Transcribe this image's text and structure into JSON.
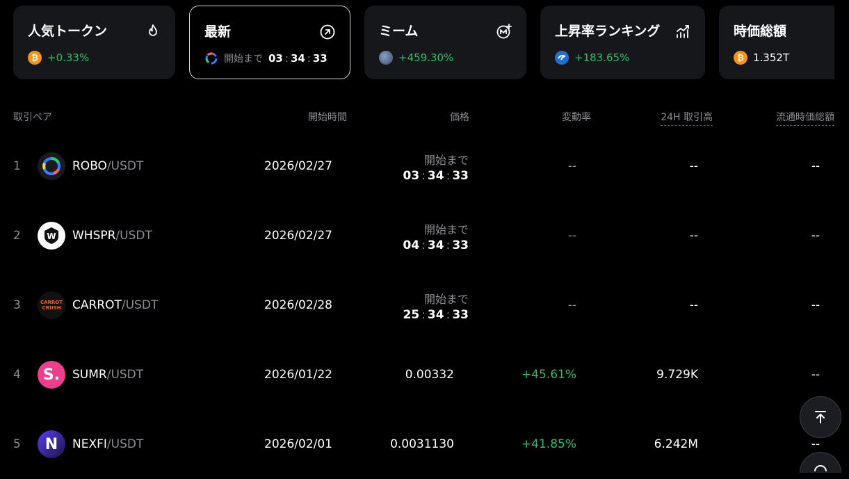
{
  "cards": [
    {
      "title": "人気トークン",
      "icon": "flame-icon",
      "coin": "₿",
      "value": "+0.33%"
    },
    {
      "title": "最新",
      "icon": "arrow-up-right-circle-icon",
      "label": "開始まで",
      "h": "03",
      "m": "34",
      "s": "33"
    },
    {
      "title": "ミーム",
      "icon": "meme-plus-icon",
      "value": "+459.30%"
    },
    {
      "title": "上昇率ランキング",
      "icon": "bar-chart-rising-icon",
      "value": "+183.65%"
    },
    {
      "title": "時価総額",
      "coin": "₿",
      "value": "1.352T"
    }
  ],
  "headers": {
    "pair": "取引ペア",
    "start": "開始時間",
    "price": "価格",
    "change": "変動率",
    "volume": "24H 取引高",
    "mcap": "流通時価総額"
  },
  "sep": ":",
  "rows": [
    {
      "rank": "1",
      "base": "ROBO",
      "quote": "/USDT",
      "date": "2026/02/27",
      "countdown": {
        "label": "開始まで",
        "h": "03",
        "m": "34",
        "s": "33"
      },
      "change": "--",
      "volume": "--",
      "mcap": "--"
    },
    {
      "rank": "2",
      "base": "WHSPR",
      "quote": "/USDT",
      "date": "2026/02/27",
      "countdown": {
        "label": "開始まで",
        "h": "04",
        "m": "34",
        "s": "33"
      },
      "change": "--",
      "volume": "--",
      "mcap": "--"
    },
    {
      "rank": "3",
      "base": "CARROT",
      "quote": "/USDT",
      "date": "2026/02/28",
      "countdown": {
        "label": "開始まで",
        "h": "25",
        "m": "34",
        "s": "33"
      },
      "change": "--",
      "volume": "--",
      "mcap": "--"
    },
    {
      "rank": "4",
      "base": "SUMR",
      "quote": "/USDT",
      "date": "2026/01/22",
      "price": "0.00332",
      "change": "+45.61%",
      "volume": "9.729K",
      "mcap": "--"
    },
    {
      "rank": "5",
      "base": "NEXFI",
      "quote": "/USDT",
      "date": "2026/02/01",
      "price": "0.0031130",
      "change": "+41.85%",
      "volume": "6.242M",
      "mcap": "--"
    }
  ],
  "logos": {
    "whspr": "W",
    "carrot_top": "CARROT",
    "carrot_bottom": "CRUSH",
    "sumr": "S.",
    "nexfi": "N"
  },
  "colors": {
    "background": "#000000",
    "card": "#16171b",
    "positive": "#2ebd6b",
    "muted": "#8b8d94",
    "sumr": "#ee3f8f"
  }
}
